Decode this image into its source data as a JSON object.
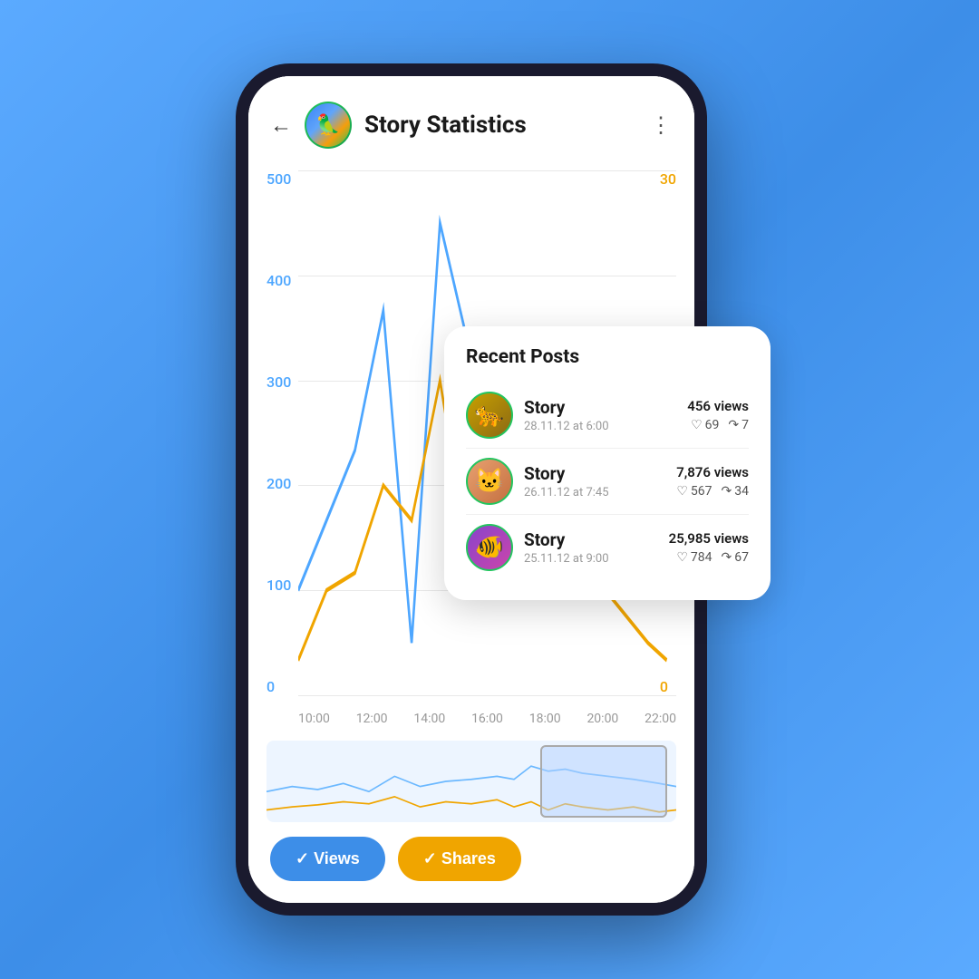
{
  "header": {
    "back_label": "←",
    "title": "Story Statistics",
    "more_icon": "⋮"
  },
  "chart": {
    "y_labels_left": [
      "500",
      "400",
      "300",
      "200",
      "100",
      "0"
    ],
    "y_labels_right": [
      "30",
      "",
      "",
      "",
      "",
      "0"
    ],
    "x_labels": [
      "10:00",
      "12:00",
      "14:00",
      "16:00",
      "18:00",
      "20:00",
      "22:00"
    ]
  },
  "filters": {
    "views_label": "✓ Views",
    "shares_label": "✓ Shares"
  },
  "recent_posts": {
    "title": "Recent Posts",
    "posts": [
      {
        "name": "Story",
        "date": "28.11.12 at 6:00",
        "views": "456 views",
        "likes": "69",
        "shares": "7",
        "animal": "🐆"
      },
      {
        "name": "Story",
        "date": "26.11.12 at 7:45",
        "views": "7,876 views",
        "likes": "567",
        "shares": "34",
        "animal": "🐱"
      },
      {
        "name": "Story",
        "date": "25.11.12 at 9:00",
        "views": "25,985 views",
        "likes": "784",
        "shares": "67",
        "animal": "🐠"
      }
    ]
  },
  "avatar": {
    "emoji": "🦜"
  }
}
